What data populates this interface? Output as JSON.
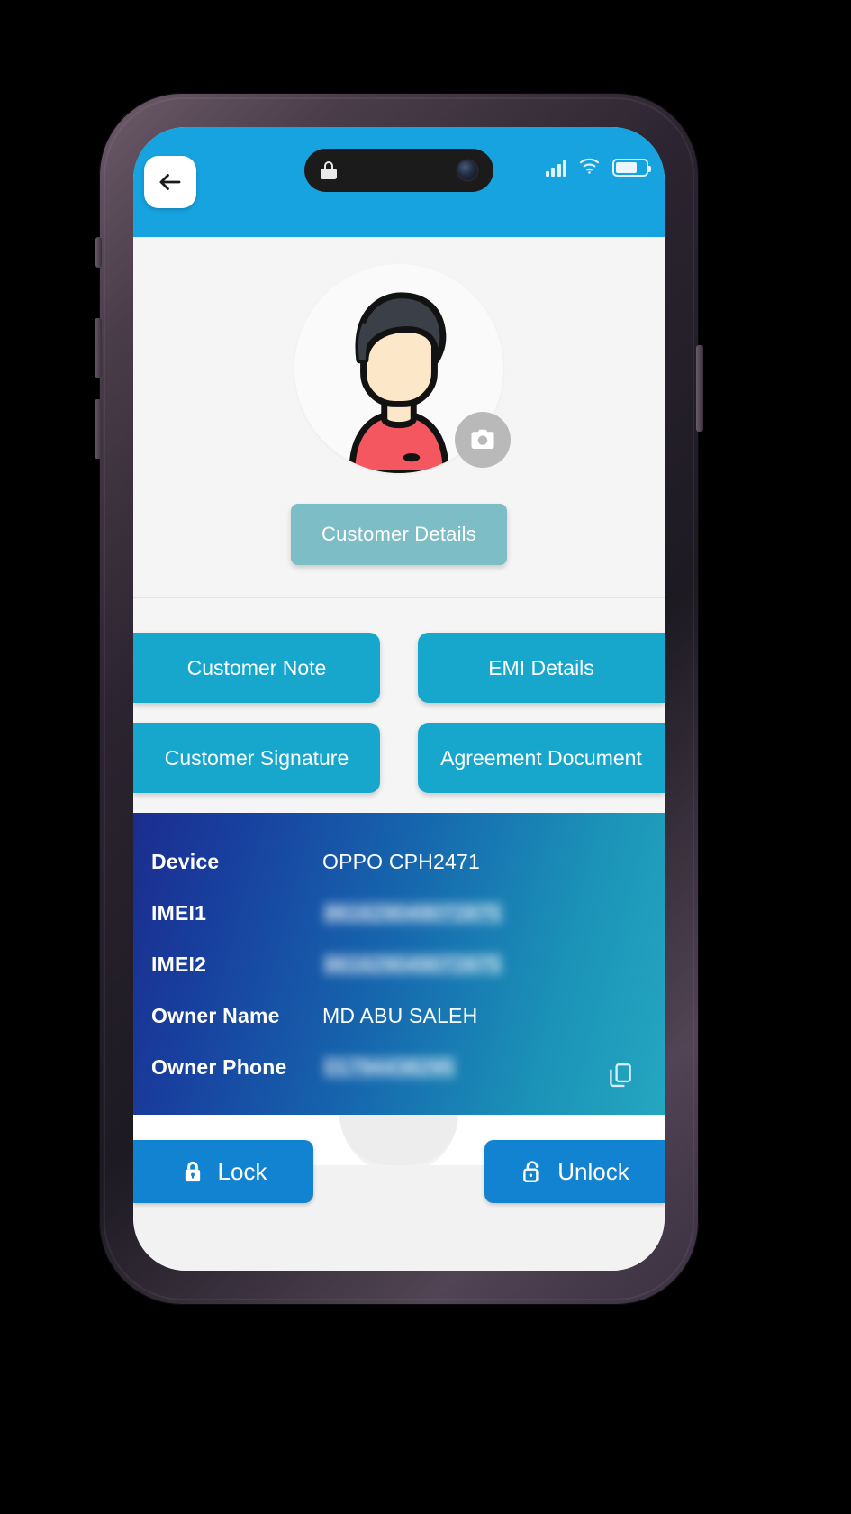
{
  "status_bar": {
    "signal_icon": "cellular-signal-icon",
    "wifi_icon": "wifi-icon",
    "battery_icon": "battery-icon",
    "island_lock_icon": "lock-icon",
    "island_camera_icon": "front-camera-icon"
  },
  "header": {
    "back_icon": "arrow-left-icon",
    "accent_color": "#17a2e0"
  },
  "profile": {
    "avatar_icon": "user-avatar-icon",
    "camera_badge_icon": "camera-icon",
    "customer_details_label": "Customer Details",
    "customer_details_color": "#7dbdc6"
  },
  "actions": {
    "color": "#18a7cc",
    "items": [
      {
        "label": "Customer Note"
      },
      {
        "label": "EMI Details"
      },
      {
        "label": "Customer Signature"
      },
      {
        "label": "Agreement Document"
      }
    ]
  },
  "device_info": {
    "rows": [
      {
        "label": "Device",
        "value": "OPPO CPH2471",
        "redacted": false
      },
      {
        "label": "IMEI1",
        "value": "861629049072875",
        "redacted": true
      },
      {
        "label": "IMEI2",
        "value": "861629049072875",
        "redacted": true
      },
      {
        "label": "Owner Name",
        "value": "MD ABU SALEH",
        "redacted": false
      },
      {
        "label": "Owner Phone",
        "value": "01794438295",
        "redacted": true
      }
    ],
    "copy_icon": "copy-icon"
  },
  "bottom_bar": {
    "lock_label": "Lock",
    "lock_icon": "padlock-closed-icon",
    "unlock_label": "Unlock",
    "unlock_icon": "padlock-open-icon",
    "button_color": "#1283d0"
  }
}
